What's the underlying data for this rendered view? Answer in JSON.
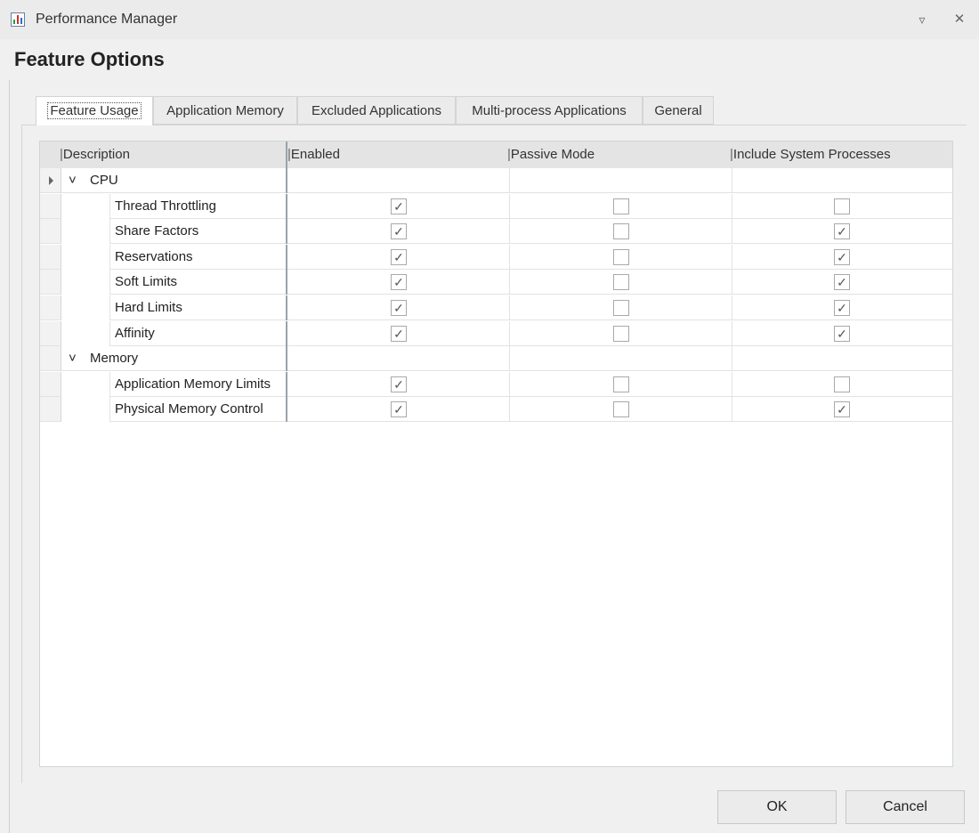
{
  "window": {
    "title": "Performance Manager"
  },
  "page_title": "Feature Options",
  "tabs": [
    {
      "label": "Feature Usage",
      "active": true
    },
    {
      "label": "Application Memory",
      "active": false
    },
    {
      "label": "Excluded Applications",
      "active": false
    },
    {
      "label": "Multi-process Applications",
      "active": false
    },
    {
      "label": "General",
      "active": false
    }
  ],
  "grid": {
    "columns": [
      "Description",
      "Enabled",
      "Passive Mode",
      "Include System Processes"
    ],
    "groups": [
      {
        "name": "CPU",
        "rows": [
          {
            "name": "Thread Throttling",
            "enabled": true,
            "passive": false,
            "system": false
          },
          {
            "name": "Share Factors",
            "enabled": true,
            "passive": false,
            "system": true
          },
          {
            "name": "Reservations",
            "enabled": true,
            "passive": false,
            "system": true
          },
          {
            "name": "Soft Limits",
            "enabled": true,
            "passive": false,
            "system": true
          },
          {
            "name": "Hard Limits",
            "enabled": true,
            "passive": false,
            "system": true
          },
          {
            "name": "Affinity",
            "enabled": true,
            "passive": false,
            "system": true
          }
        ]
      },
      {
        "name": "Memory",
        "rows": [
          {
            "name": "Application Memory Limits",
            "enabled": true,
            "passive": false,
            "system": false
          },
          {
            "name": "Physical Memory Control",
            "enabled": true,
            "passive": false,
            "system": true
          }
        ]
      }
    ]
  },
  "buttons": {
    "ok": "OK",
    "cancel": "Cancel"
  }
}
